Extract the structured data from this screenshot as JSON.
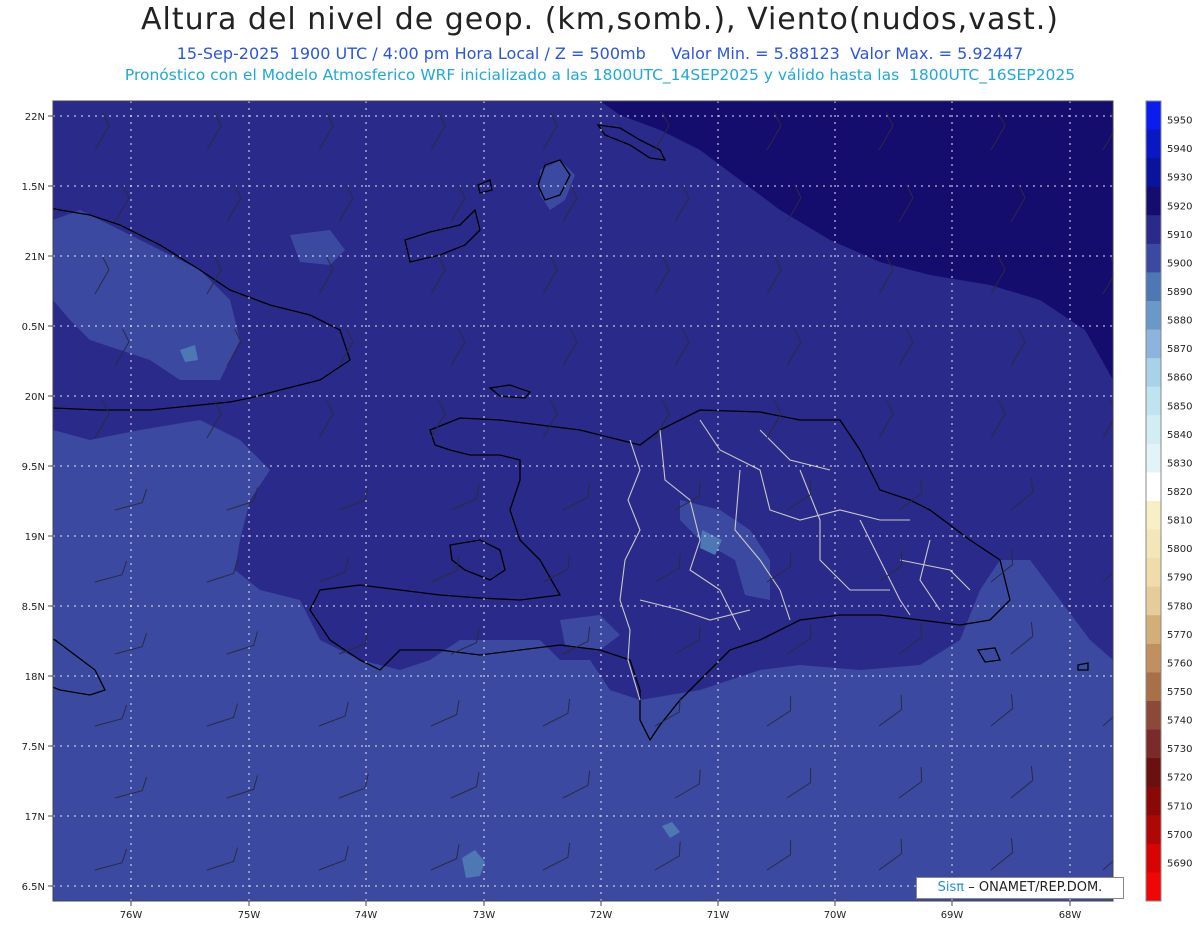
{
  "title": "Altura del nivel de geop. (km,somb.), Viento(nudos,vast.)",
  "subtitle_line1": "15-Sep-2025  1900 UTC / 4:00 pm Hora Local / Z = 500mb     Valor Min. = 5.88123  Valor Max. = 5.92447",
  "subtitle_line2": "Pronóstico con el Modelo Atmosferico WRF inicializado a las 1800UTC_14SEP2025 y válido hasta las  1800UTC_16SEP2025",
  "credit": {
    "logo": "Sisπ",
    "text": "– ONAMET/REP.DOM."
  },
  "lat_labels": [
    "22N",
    "1.5N",
    "21N",
    "0.5N",
    "20N",
    "9.5N",
    "19N",
    "8.5N",
    "18N",
    "7.5N",
    "17N",
    "6.5N"
  ],
  "lon_labels": [
    "76W",
    "75W",
    "74W",
    "73W",
    "72W",
    "71W",
    "70W",
    "69W",
    "68W"
  ],
  "colorbar_labels": [
    "5950",
    "5940",
    "5930",
    "5920",
    "5910",
    "5900",
    "5890",
    "5880",
    "5870",
    "5860",
    "5850",
    "5840",
    "5830",
    "5820",
    "5810",
    "5800",
    "5790",
    "5780",
    "5770",
    "5760",
    "5750",
    "5740",
    "5730",
    "5720",
    "5710",
    "5700",
    "5690"
  ],
  "colorbar_colors": [
    "#0b1cf0",
    "#0a17c4",
    "#0b129c",
    "#140d6e",
    "#2a2a8a",
    "#3b4aa0",
    "#4e78b4",
    "#6a98c8",
    "#8cb4dc",
    "#a8d2e8",
    "#c0e4ef",
    "#d2eef4",
    "#e2f4f8",
    "#ffffff",
    "#f8efc6",
    "#f3e6b8",
    "#efdcaa",
    "#e6cc98",
    "#d4ae78",
    "#c09060",
    "#a87048",
    "#8c4838",
    "#7a2a2a",
    "#6a1010",
    "#8a0808",
    "#b00606",
    "#d80404",
    "#f00606"
  ],
  "colors": {
    "level_5920": "#140d6e",
    "level_5910": "#2a2a8a",
    "level_5900": "#3b4aa0",
    "level_5890": "#4e78b4",
    "coast": "#000000",
    "provinces": "#c8c8c8"
  }
}
